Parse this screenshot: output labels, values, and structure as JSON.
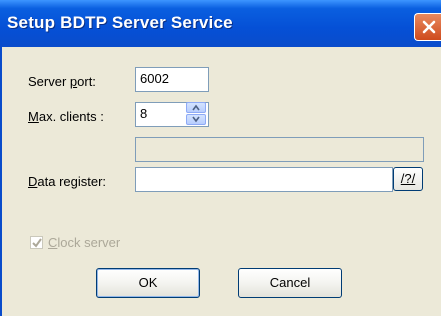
{
  "window": {
    "title": "Setup BDTP Server Service"
  },
  "form": {
    "server_port": {
      "label_pre": "Server ",
      "label_accel": "p",
      "label_post": "ort:",
      "value": "6002"
    },
    "max_clients": {
      "label_accel": "M",
      "label_post": "ax. clients :",
      "value": "8"
    },
    "data_register": {
      "label_accel": "D",
      "label_post": "ata register:",
      "value": "",
      "browse_label": "/?/"
    },
    "clock_server": {
      "label_accel": "C",
      "label_post": "lock server",
      "checked": true,
      "enabled": false
    }
  },
  "buttons": {
    "ok_label": "OK",
    "cancel_label": "Cancel"
  },
  "colors": {
    "titlebar": "#0a4ccb",
    "close": "#cf4b1d",
    "dialog_bg": "#ece9d8"
  }
}
